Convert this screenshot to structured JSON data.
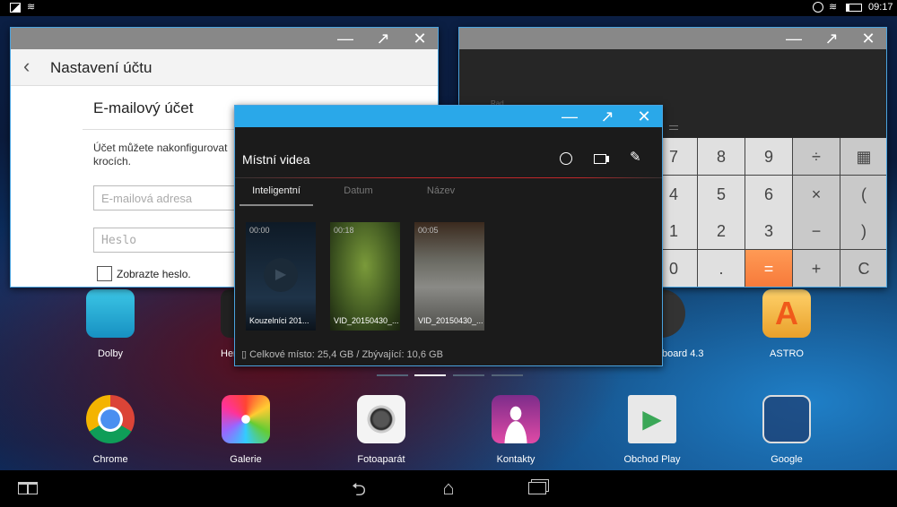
{
  "status": {
    "time": "09:17",
    "icons": [
      "image-icon",
      "wifi-icon",
      "sync-icon",
      "wifi-icon",
      "battery-icon"
    ]
  },
  "settings_window": {
    "title": "Nastavení účtu",
    "section": "E-mailový účet",
    "description_line1": "Účet můžete nakonfigurovat",
    "description_line2": "krocích.",
    "email_placeholder": "E-mailová adresa",
    "password_placeholder": "Heslo",
    "show_password": "Zobrazte heslo.",
    "show_password_checked": false
  },
  "calculator_window": {
    "mode": "Rad",
    "keys": [
      [
        "7",
        "8",
        "9",
        "÷",
        "▦"
      ],
      [
        "4",
        "5",
        "6",
        "×",
        "("
      ],
      [
        "1",
        "2",
        "3",
        "−",
        ")"
      ],
      [
        "0",
        ".",
        "=",
        "+",
        "C"
      ]
    ]
  },
  "video_window": {
    "title": "Místní videa",
    "tabs": [
      {
        "label": "Inteligentní",
        "active": true
      },
      {
        "label": "Datum"
      },
      {
        "label": "Název"
      }
    ],
    "videos": [
      {
        "duration": "00:00",
        "name": "Kouzelníci 201..."
      },
      {
        "duration": "00:18",
        "name": "VID_20150430_..."
      },
      {
        "duration": "00:05",
        "name": "VID_20150430_..."
      }
    ],
    "storage": "Celkové místo: 25,4 GB / Zbývající: 10,6 GB",
    "accent": "#2aa8e9"
  },
  "window_controls": {
    "minimize": "—",
    "maximize": "↗",
    "close": "✕"
  },
  "desktop": {
    "row1": [
      {
        "label": "Dolby"
      },
      {
        "label": "Her"
      },
      {
        "label": "board 4.3"
      },
      {
        "label": "ASTRO"
      }
    ],
    "row2": [
      {
        "label": "Chrome"
      },
      {
        "label": "Galerie"
      },
      {
        "label": "Fotoaparát"
      },
      {
        "label": "Kontakty"
      },
      {
        "label": "Obchod Play"
      },
      {
        "label": "Google"
      }
    ],
    "pages": 4,
    "active_page": 2
  }
}
